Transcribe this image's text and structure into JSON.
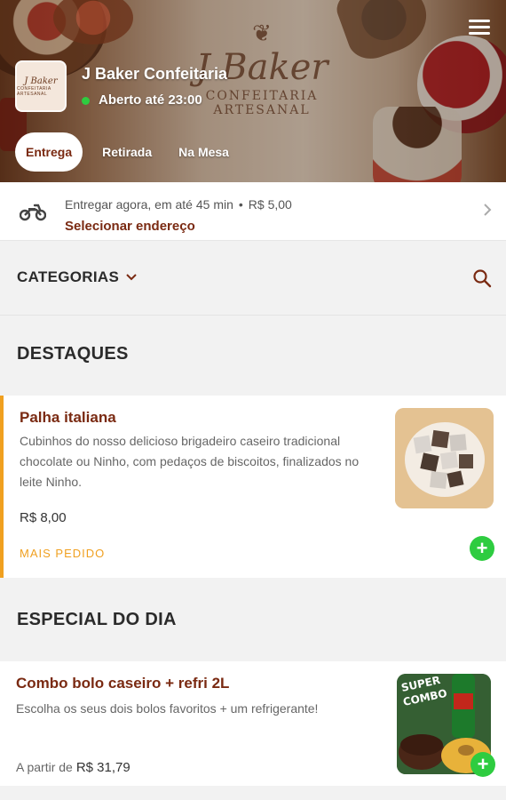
{
  "store": {
    "name": "J Baker Confeitaria",
    "status": "Aberto até 23:00",
    "logo_text": "J Baker",
    "logo_sub": "CONFEITARIA ARTESANAL",
    "watermark_name": "J Baker",
    "watermark_line1": "CONFEITARIA",
    "watermark_line2": "ARTESANAL"
  },
  "tabs": [
    {
      "label": "Entrega",
      "active": true
    },
    {
      "label": "Retirada",
      "active": false
    },
    {
      "label": "Na Mesa",
      "active": false
    }
  ],
  "delivery": {
    "eta": "Entregar agora, em até 45 min",
    "fee": "R$ 5,00",
    "action": "Selecionar endereço"
  },
  "categories": {
    "label": "CATEGORIAS"
  },
  "sections": [
    {
      "title": "DESTAQUES",
      "products": [
        {
          "name": "Palha italiana",
          "description": "Cubinhos do nosso delicioso brigadeiro caseiro tradicional chocolate ou Ninho, com pedaços de biscoitos, finalizados no leite Ninho.",
          "price": "R$ 8,00",
          "badge": "MAIS PEDIDO"
        }
      ]
    },
    {
      "title": "ESPECIAL DO DIA",
      "products": [
        {
          "name": "Combo bolo caseiro + refri 2L",
          "description": "Escolha os seus dois bolos favoritos + um refrigerante!",
          "price_prefix": "A partir de",
          "price": "R$ 31,79",
          "image_text": "SUPER COMBO"
        }
      ]
    }
  ],
  "colors": {
    "brand": "#7a2a12",
    "accent_badge": "#f0a020",
    "add_button": "#2ecc40",
    "status_open": "#2ecc40"
  },
  "icons": [
    "menu-icon",
    "motorcycle-icon",
    "chevron-right-icon",
    "chevron-down-icon",
    "search-icon",
    "plus-icon"
  ]
}
